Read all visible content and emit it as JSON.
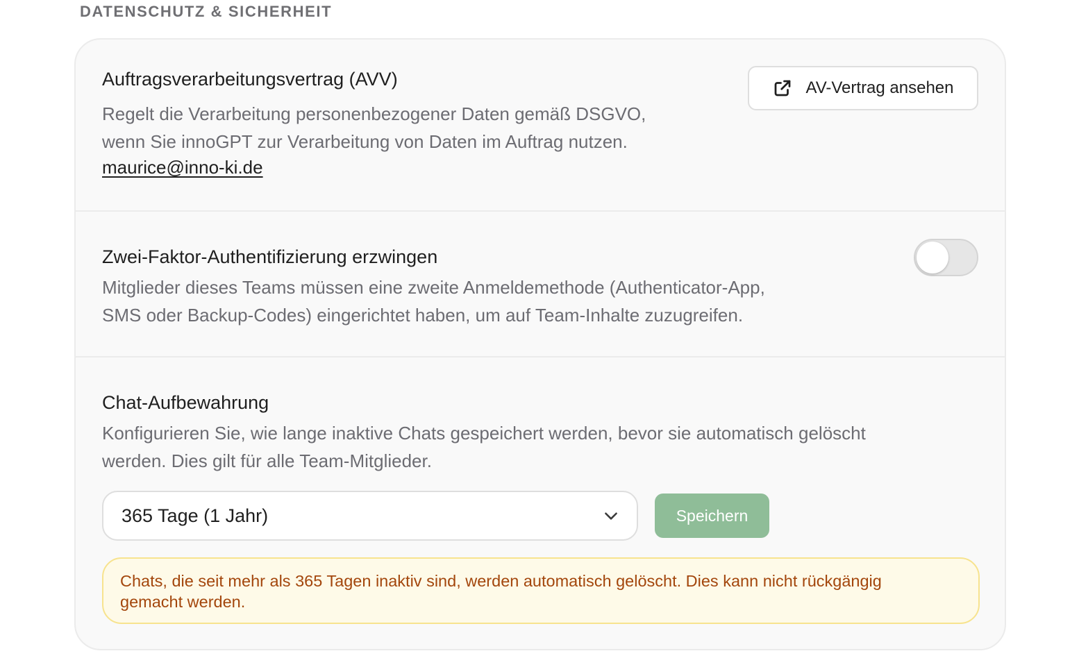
{
  "section_title": "DATENSCHUTZ & SICHERHEIT",
  "avv": {
    "title": "Auftragsverarbeitungsvertrag (AVV)",
    "description_line1": "Regelt die Verarbeitung personenbezogener Daten gemäß DSGVO,",
    "description_line2": "wenn Sie innoGPT zur Verarbeitung von Daten im Auftrag nutzen.",
    "email": "maurice@inno-ki.de",
    "button_label": "AV-Vertrag ansehen",
    "button_icon": "external-link-icon"
  },
  "two_factor": {
    "title": "Zwei-Faktor-Authentifizierung erzwingen",
    "description_line1": "Mitglieder dieses Teams müssen eine zweite Anmeldemethode (Authenticator-App,",
    "description_line2": "SMS oder Backup-Codes) eingerichtet haben, um auf Team-Inhalte zuzugreifen.",
    "enabled": false
  },
  "retention": {
    "title": "Chat-Aufbewahrung",
    "description_line1": "Konfigurieren Sie, wie lange inaktive Chats gespeichert werden, bevor sie automatisch gelöscht",
    "description_line2": "werden. Dies gilt für alle Team-Mitglieder.",
    "selected_option": "365 Tage (1 Jahr)",
    "save_label": "Speichern",
    "warning_line1": "Chats, die seit mehr als 365 Tagen inaktiv sind, werden automatisch gelöscht. Dies kann nicht rückgängig",
    "warning_line2": "gemacht werden."
  },
  "colors": {
    "save_button": "#8fbd98",
    "warning_text": "#a3460c",
    "warning_bg": "#fefae8",
    "warning_border": "#f7e38e"
  }
}
